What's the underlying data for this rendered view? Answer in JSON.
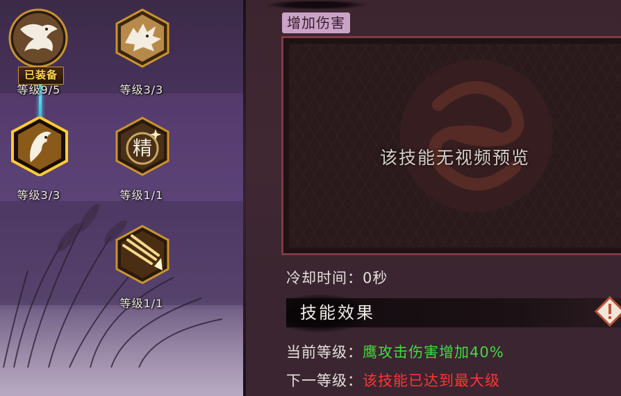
{
  "skill_tree": {
    "nodes": [
      {
        "id": "eagle-head",
        "icon": "eagle-icon",
        "level_text": "等级9/5",
        "equipped_badge": "已装备"
      },
      {
        "id": "wolf",
        "icon": "wolf-icon",
        "level_text": "等级3/3"
      },
      {
        "id": "eagle-selected",
        "icon": "eagle-feather-icon",
        "level_text": "等级3/3"
      },
      {
        "id": "jing",
        "icon": "jing-icon",
        "icon_glyph": "精",
        "level_text": "等级1/1"
      },
      {
        "id": "arrows",
        "icon": "arrow-burst-icon",
        "level_text": "等级1/1"
      }
    ]
  },
  "detail": {
    "title": "增加伤害",
    "video_placeholder": "该技能无视频预览",
    "cooldown": "冷却时间：0秒",
    "effect_section_title": "技能效果",
    "current_level_label": "当前等级：",
    "current_level_value": "鹰攻击伤害增加40%",
    "next_level_label": "下一等级：",
    "next_level_value": "该技能已达到最大级"
  },
  "colors": {
    "gold": "#c9942e",
    "green_value": "#3fdc3f",
    "red_value": "#ff3434",
    "title_tag_bg": "#c9a4c7",
    "frame_border": "#7e3a44",
    "connector": "#5ae8ff"
  }
}
